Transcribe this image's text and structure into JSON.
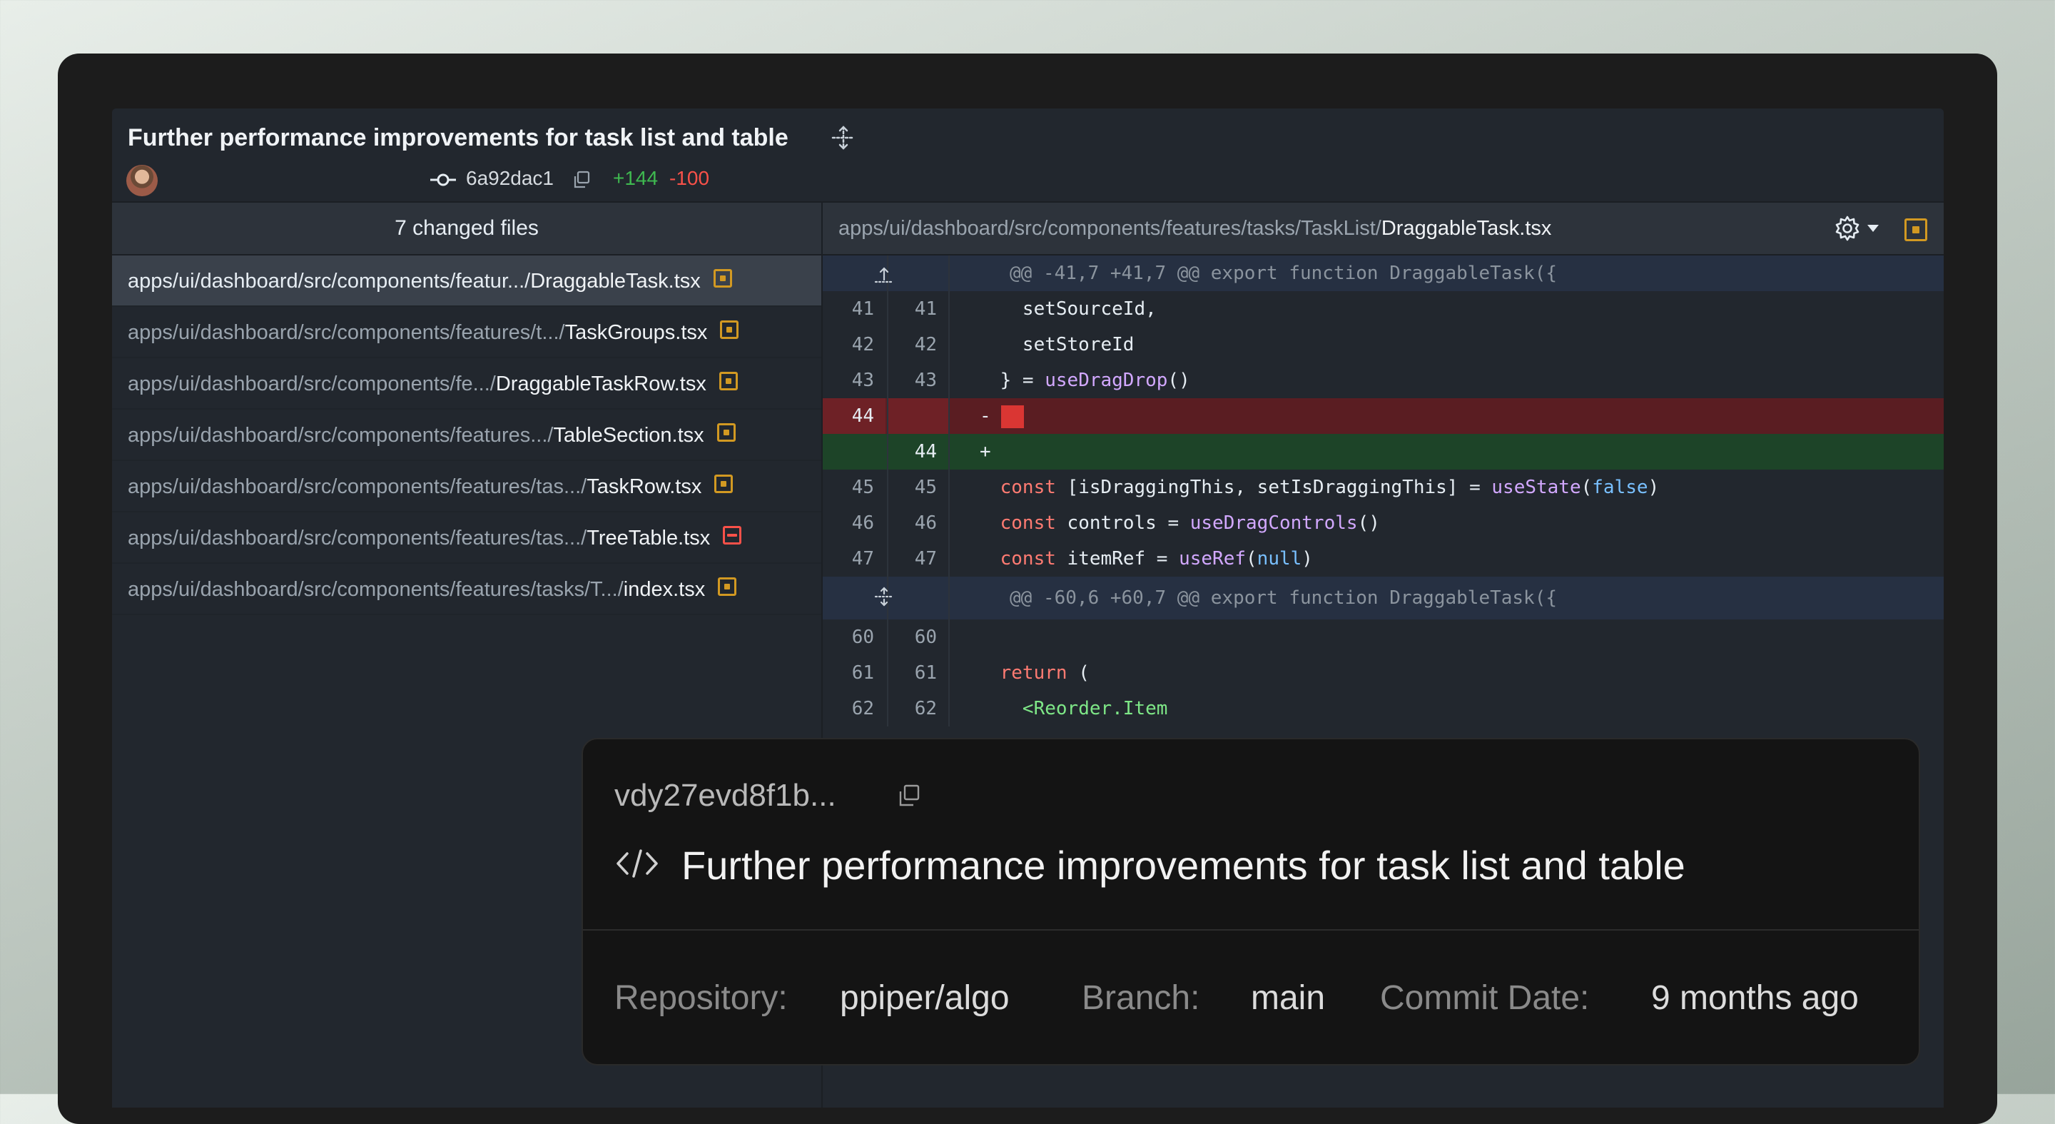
{
  "commit": {
    "title": "Further performance improvements for task list and table",
    "hash": "6a92dac1",
    "additions": "+144",
    "deletions": "-100"
  },
  "files": {
    "header": "7 changed files",
    "items": [
      {
        "dir": "apps/ui/dashboard/src/components/featur.../",
        "name": "DraggableTask.tsx",
        "status": "modified",
        "active": true
      },
      {
        "dir": "apps/ui/dashboard/src/components/features/t.../",
        "name": "TaskGroups.tsx",
        "status": "modified"
      },
      {
        "dir": "apps/ui/dashboard/src/components/fe.../",
        "name": "DraggableTaskRow.tsx",
        "status": "modified"
      },
      {
        "dir": "apps/ui/dashboard/src/components/features.../",
        "name": "TableSection.tsx",
        "status": "modified"
      },
      {
        "dir": "apps/ui/dashboard/src/components/features/tas.../",
        "name": "TaskRow.tsx",
        "status": "modified"
      },
      {
        "dir": "apps/ui/dashboard/src/components/features/tas.../",
        "name": "TreeTable.tsx",
        "status": "deleted"
      },
      {
        "dir": "apps/ui/dashboard/src/components/features/tasks/T.../",
        "name": "index.tsx",
        "status": "modified"
      }
    ]
  },
  "diff": {
    "path_dir": "apps/ui/dashboard/src/components/features/tasks/TaskList/",
    "path_file": "DraggableTask.tsx",
    "hunk1": "@@ -41,7 +41,7 @@ export function DraggableTask({",
    "hunk2": "@@ -60,6 +60,7 @@ export function DraggableTask({",
    "lines": [
      {
        "old": "41",
        "new": "41",
        "text": "      setSourceId,"
      },
      {
        "old": "42",
        "new": "42",
        "text": "      setStoreId"
      },
      {
        "old": "43",
        "new": "43",
        "pre": "    } = ",
        "fn": "useDragDrop",
        "post": "()"
      },
      {
        "old": "44",
        "new": "",
        "sign": "-"
      },
      {
        "old": "",
        "new": "44",
        "sign": "+"
      },
      {
        "old": "45",
        "new": "45",
        "kw": "const",
        "mid": " [isDraggingThis, setIsDraggingThis] = ",
        "fn": "useState",
        "lit": "false"
      },
      {
        "old": "46",
        "new": "46",
        "kw": "const",
        "mid": " controls = ",
        "fn": "useDragControls",
        "post": "()"
      },
      {
        "old": "47",
        "new": "47",
        "kw": "const",
        "mid": " itemRef = ",
        "fn": "useRef",
        "lit": "null"
      },
      {
        "old": "60",
        "new": "60"
      },
      {
        "old": "61",
        "new": "61",
        "kw": "return",
        "post": " ("
      },
      {
        "old": "62",
        "new": "62",
        "tag": "<Reorder.Item"
      }
    ]
  },
  "card": {
    "hash": "vdy27evd8f1b...",
    "title": "Further performance improvements for task list and table",
    "repo_label": "Repository:",
    "repo": "ppiper/algo",
    "branch_label": "Branch:",
    "branch": "main",
    "date_label": "Commit Date:",
    "date": "9 months ago"
  },
  "colors": {
    "added": "#3fb950",
    "removed": "#f85149",
    "modified_badge": "#d29922"
  }
}
